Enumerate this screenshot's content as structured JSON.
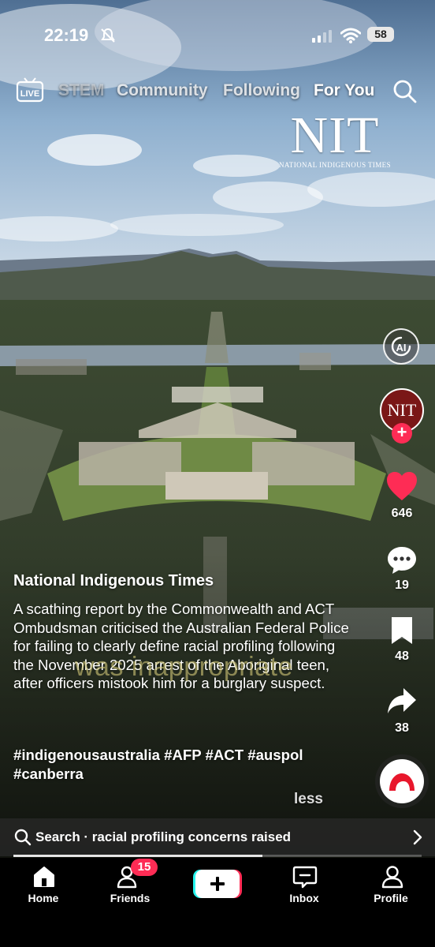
{
  "status_bar": {
    "time": "22:19",
    "battery": "58"
  },
  "top_nav": {
    "live_label": "LIVE",
    "tabs": [
      {
        "label": "STEM"
      },
      {
        "label": "Community"
      },
      {
        "label": "Following"
      },
      {
        "label": "For You",
        "active": true
      }
    ]
  },
  "video": {
    "logo_letters": "NIT",
    "logo_subtitle": "NATIONAL INDIGENOUS TIMES",
    "subtitle_overlay": "was inappropriate"
  },
  "right_rail": {
    "ai_label": "AI",
    "avatar_letters": "NIT",
    "likes": "646",
    "comments": "19",
    "bookmarks": "48",
    "shares": "38"
  },
  "caption": {
    "author": "National Indigenous Times",
    "description": "A scathing report by the Commonwealth and ACT Ombudsman criticised the Australian Federal Police for failing to clearly define racial profiling following the November 2025 arrest of the Aboriginal teen, after officers mistook him for a burglary suspect.",
    "hashtags": "#indigenousaustralia #AFP #ACT #auspol #canberra",
    "less_label": "less"
  },
  "search_bar": {
    "text": "Search · racial profiling concerns raised"
  },
  "playback": {
    "progress": 0.61
  },
  "bottom_nav": {
    "home": "Home",
    "friends": "Friends",
    "friends_badge": "15",
    "inbox": "Inbox",
    "profile": "Profile"
  },
  "colors": {
    "accent": "#fe2c55",
    "avatar_bg": "#7a1717"
  }
}
